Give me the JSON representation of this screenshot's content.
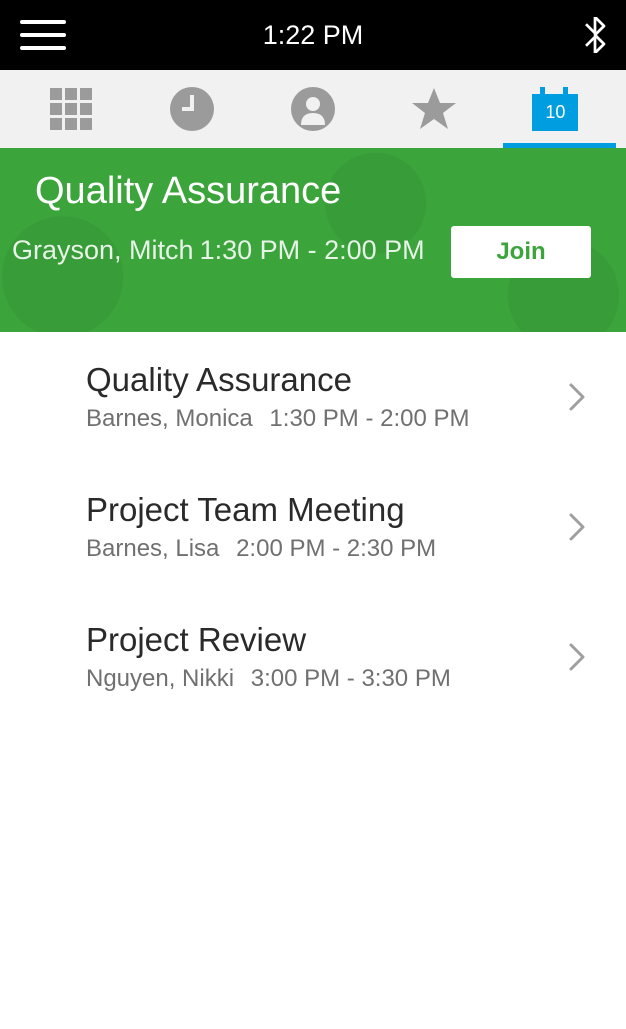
{
  "status_bar": {
    "time": "1:22 PM"
  },
  "tabs": {
    "calendar_day": "10"
  },
  "featured": {
    "title": "Quality Assurance",
    "person": "Grayson, Mitch",
    "time": "1:30 PM - 2:00 PM",
    "join_label": "Join"
  },
  "meetings": [
    {
      "title": "Quality Assurance",
      "person": "Barnes, Monica",
      "time": "1:30 PM - 2:00 PM"
    },
    {
      "title": "Project Team Meeting",
      "person": "Barnes, Lisa",
      "time": "2:00 PM - 2:30 PM"
    },
    {
      "title": "Project Review",
      "person": "Nguyen, Nikki",
      "time": "3:00 PM - 3:30 PM"
    }
  ]
}
